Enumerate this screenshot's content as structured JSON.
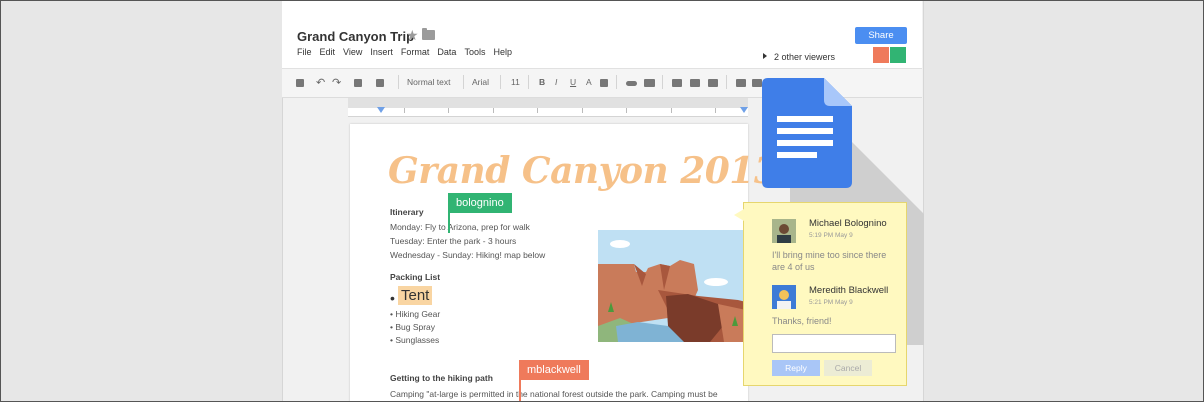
{
  "header": {
    "title": "Grand Canyon Trip",
    "menu": [
      "File",
      "Edit",
      "View",
      "Insert",
      "Format",
      "Data",
      "Tools",
      "Help"
    ],
    "share_label": "Share",
    "viewers_text": "2 other viewers"
  },
  "toolbar": {
    "style_label": "Normal text",
    "font_label": "Arial",
    "size_label": "11"
  },
  "document": {
    "title": "Grand Canyon 2013",
    "itinerary_heading": "Itinerary",
    "itinerary": [
      "Monday: Fly to Arizona, prep for walk",
      "Tuesday: Enter the park - 3 hours",
      "Wednesday - Sunday: Hiking!  map below"
    ],
    "packing_heading": "Packing List",
    "packing_big": "Tent",
    "packing": [
      "• Hiking Gear",
      "• Bug Spray",
      "• Sunglasses"
    ],
    "hiking_heading": "Getting to the hiking path",
    "hiking_text": "Camping \"at-large is permitted in the national forest outside the park. Camping must be"
  },
  "collaborators": {
    "green_flag": "bolognino",
    "orange_flag": "mblackwell"
  },
  "comments": [
    {
      "name": "Michael Bolognino",
      "time": "5:19 PM May 9",
      "text": "I'll bring mine too since there are 4 of us"
    },
    {
      "name": "Meredith Blackwell",
      "time": "5:21 PM May 9",
      "text": "Thanks, friend!"
    }
  ],
  "reply_label": "Reply",
  "cancel_label": "Cancel",
  "colors": {
    "share": "#4b8ef1",
    "green": "#31b473",
    "orange": "#ef7a5b",
    "comment_bg": "#fff9c0",
    "title": "#f6c189"
  }
}
